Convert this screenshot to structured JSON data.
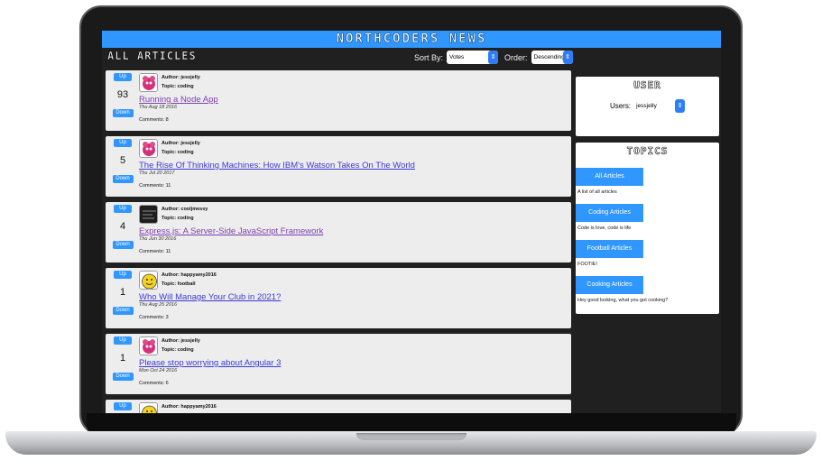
{
  "app": {
    "title": "NORTHCODERS NEWS"
  },
  "articles_section": {
    "title": "ALL ARTICLES",
    "sort_by_label": "Sort By:",
    "sort_by_value": "Votes",
    "order_label": "Order:",
    "order_value": "Descending"
  },
  "articles": [
    {
      "up": "Up",
      "votes": "93",
      "down": "Down",
      "author": "Author: jessjelly",
      "topic": "Topic: coding",
      "title": "Running a Node App",
      "date": "Thu Aug 18 2016",
      "comments": "Comments: 8",
      "avatar": "pink-monster-avatar",
      "visited": true
    },
    {
      "up": "Up",
      "votes": "5",
      "down": "Down",
      "author": "Author: jessjelly",
      "topic": "Topic: coding",
      "title": "The Rise Of Thinking Machines: How IBM's Watson Takes On The World",
      "date": "Thu Jul 20 2017",
      "comments": "Comments: 11",
      "avatar": "pink-monster-avatar",
      "visited": false
    },
    {
      "up": "Up",
      "votes": "4",
      "down": "Down",
      "author": "Author: cooljmessy",
      "topic": "Topic: coding",
      "title": "Express.js: A Server-Side JavaScript Framework",
      "date": "Thu Jun 30 2016",
      "comments": "Comments: 11",
      "avatar": "dark-noise-avatar",
      "visited": true
    },
    {
      "up": "Up",
      "votes": "1",
      "down": "Down",
      "author": "Author: happyamy2016",
      "topic": "Topic: football",
      "title": "Who Will Manage Your Club in 2021?",
      "date": "Thu Aug 25 2016",
      "comments": "Comments: 3",
      "avatar": "yellow-smiley-avatar",
      "visited": false
    },
    {
      "up": "Up",
      "votes": "1",
      "down": "Down",
      "author": "Author: jessjelly",
      "topic": "Topic: coding",
      "title": "Please stop worrying about Angular 3",
      "date": "Mon Oct 24 2016",
      "comments": "Comments: 6",
      "avatar": "pink-monster-avatar",
      "visited": false
    },
    {
      "up": "Up",
      "votes": "",
      "down": "",
      "author": "Author: happyamy2016",
      "topic": "",
      "title": "",
      "date": "",
      "comments": "",
      "avatar": "yellow-smiley-avatar",
      "visited": false
    }
  ],
  "user_panel": {
    "title": "USER",
    "users_label": "Users:",
    "users_value": "jessjelly"
  },
  "topics_panel": {
    "title": "TOPICS",
    "items": [
      {
        "label": "All Articles",
        "description": "A list of all articles"
      },
      {
        "label": "Coding Articles",
        "description": "Code is love, code is life"
      },
      {
        "label": "Football Articles",
        "description": "FOOTIE!"
      },
      {
        "label": "Cooking Articles",
        "description": "Hey good looking, what you got cooking?"
      }
    ]
  },
  "colors": {
    "accent": "#2f97ff",
    "background": "#202020",
    "card": "#ededed",
    "link": "#3d3ad6"
  }
}
